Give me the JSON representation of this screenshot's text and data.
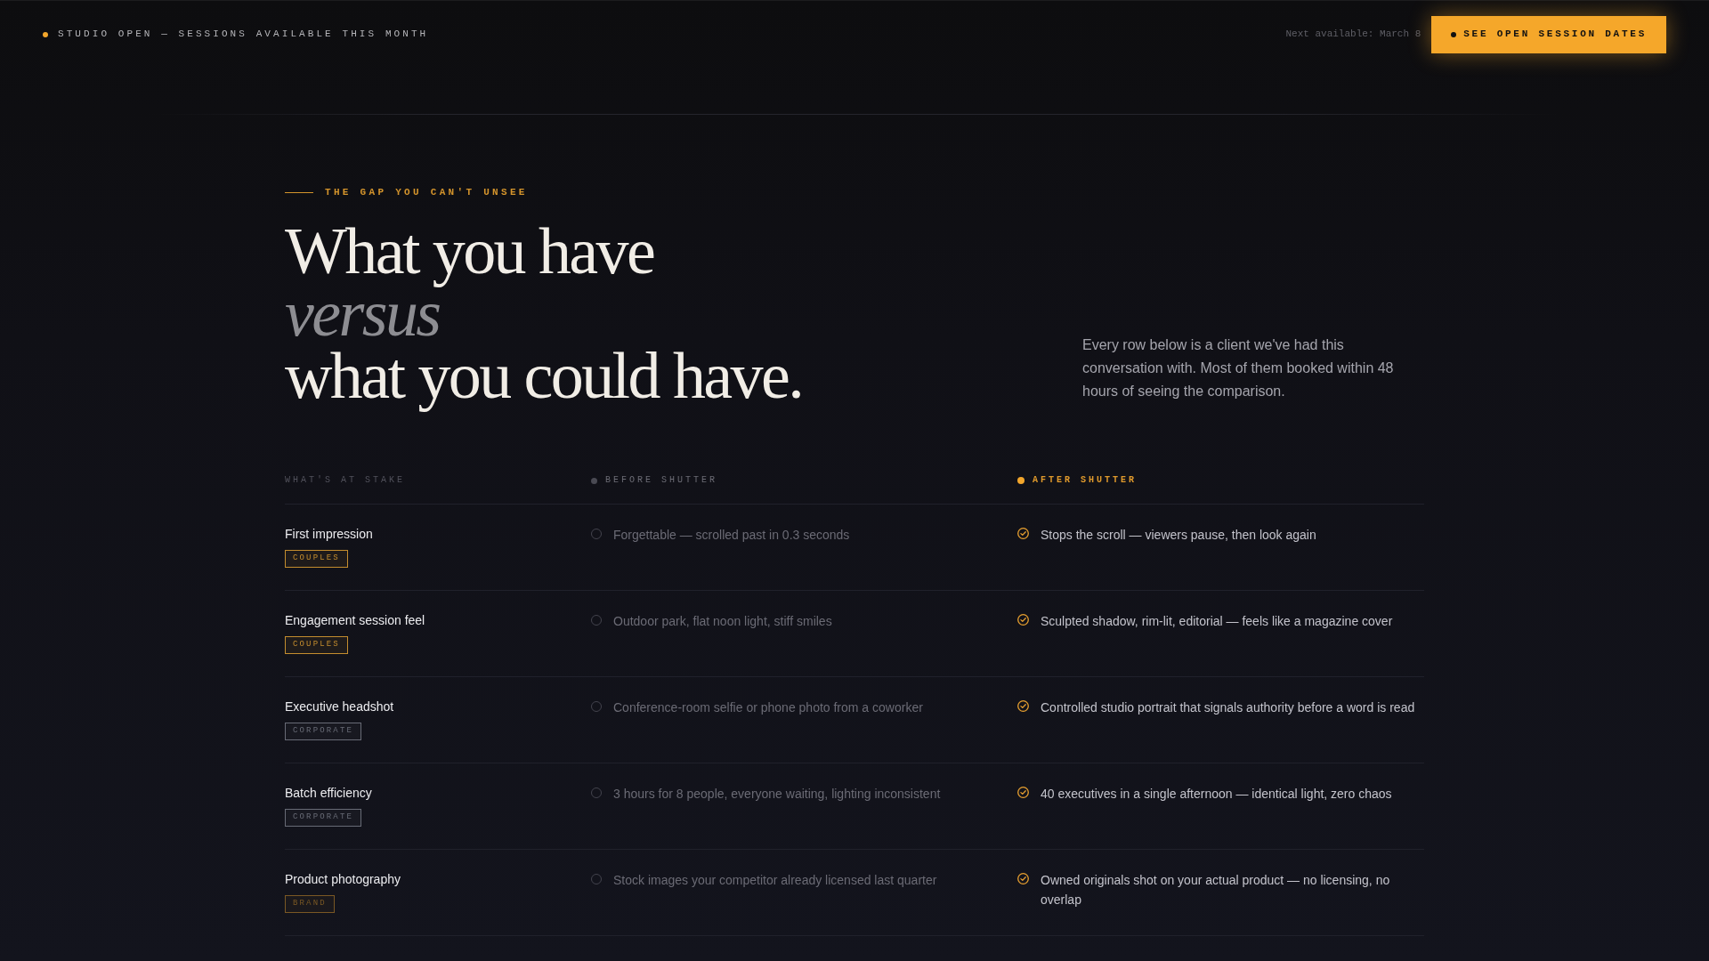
{
  "top_bar": {
    "status": "STUDIO OPEN — SESSIONS AVAILABLE THIS MONTH",
    "next_available": "Next available: March 8",
    "button": "SEE OPEN SESSION DATES"
  },
  "hero": {
    "eyebrow": "THE GAP YOU CAN'T UNSEE",
    "heading": "What you have *versus* what you could have.",
    "intro": "Every row below is a client we've had this conversation with. Most of them booked within 48 hours of seeing the comparison."
  },
  "comparison": {
    "columns": [
      {
        "kind": "stake",
        "label": "WHAT'S AT STAKE"
      },
      {
        "kind": "before",
        "label": "BEFORE SHUTTER"
      },
      {
        "kind": "after",
        "label": "AFTER SHUTTER"
      }
    ],
    "rows": [
      {
        "stake": "First impression",
        "tag": {
          "label": "COUPLES",
          "color": "#c48d2e"
        },
        "before": "Forgettable — scrolled past in 0.3 seconds",
        "after": "Stops the scroll — viewers pause, then look again"
      },
      {
        "stake": "Engagement session feel",
        "tag": {
          "label": "COUPLES",
          "color": "#c48d2e"
        },
        "before": "Outdoor park, flat noon light, stiff smiles",
        "after": "Sculpted shadow, rim-lit, editorial — feels like a magazine cover"
      },
      {
        "stake": "Executive headshot",
        "tag": {
          "label": "CORPORATE",
          "color": "#686b76"
        },
        "before": "Conference-room selfie or phone photo from a coworker",
        "after": "Controlled studio portrait that signals authority before a word is read"
      },
      {
        "stake": "Batch efficiency",
        "tag": {
          "label": "CORPORATE",
          "color": "#686b76"
        },
        "before": "3 hours for 8 people, everyone waiting, lighting inconsistent",
        "after": "40 executives in a single afternoon — identical light, zero chaos"
      },
      {
        "stake": "Product photography",
        "tag": {
          "label": "BRAND",
          "color": "#7a5824"
        },
        "before": "Stock images your competitor already licensed last quarter",
        "after": "Owned originals shot on your actual product — no licensing, no overlap"
      }
    ]
  }
}
